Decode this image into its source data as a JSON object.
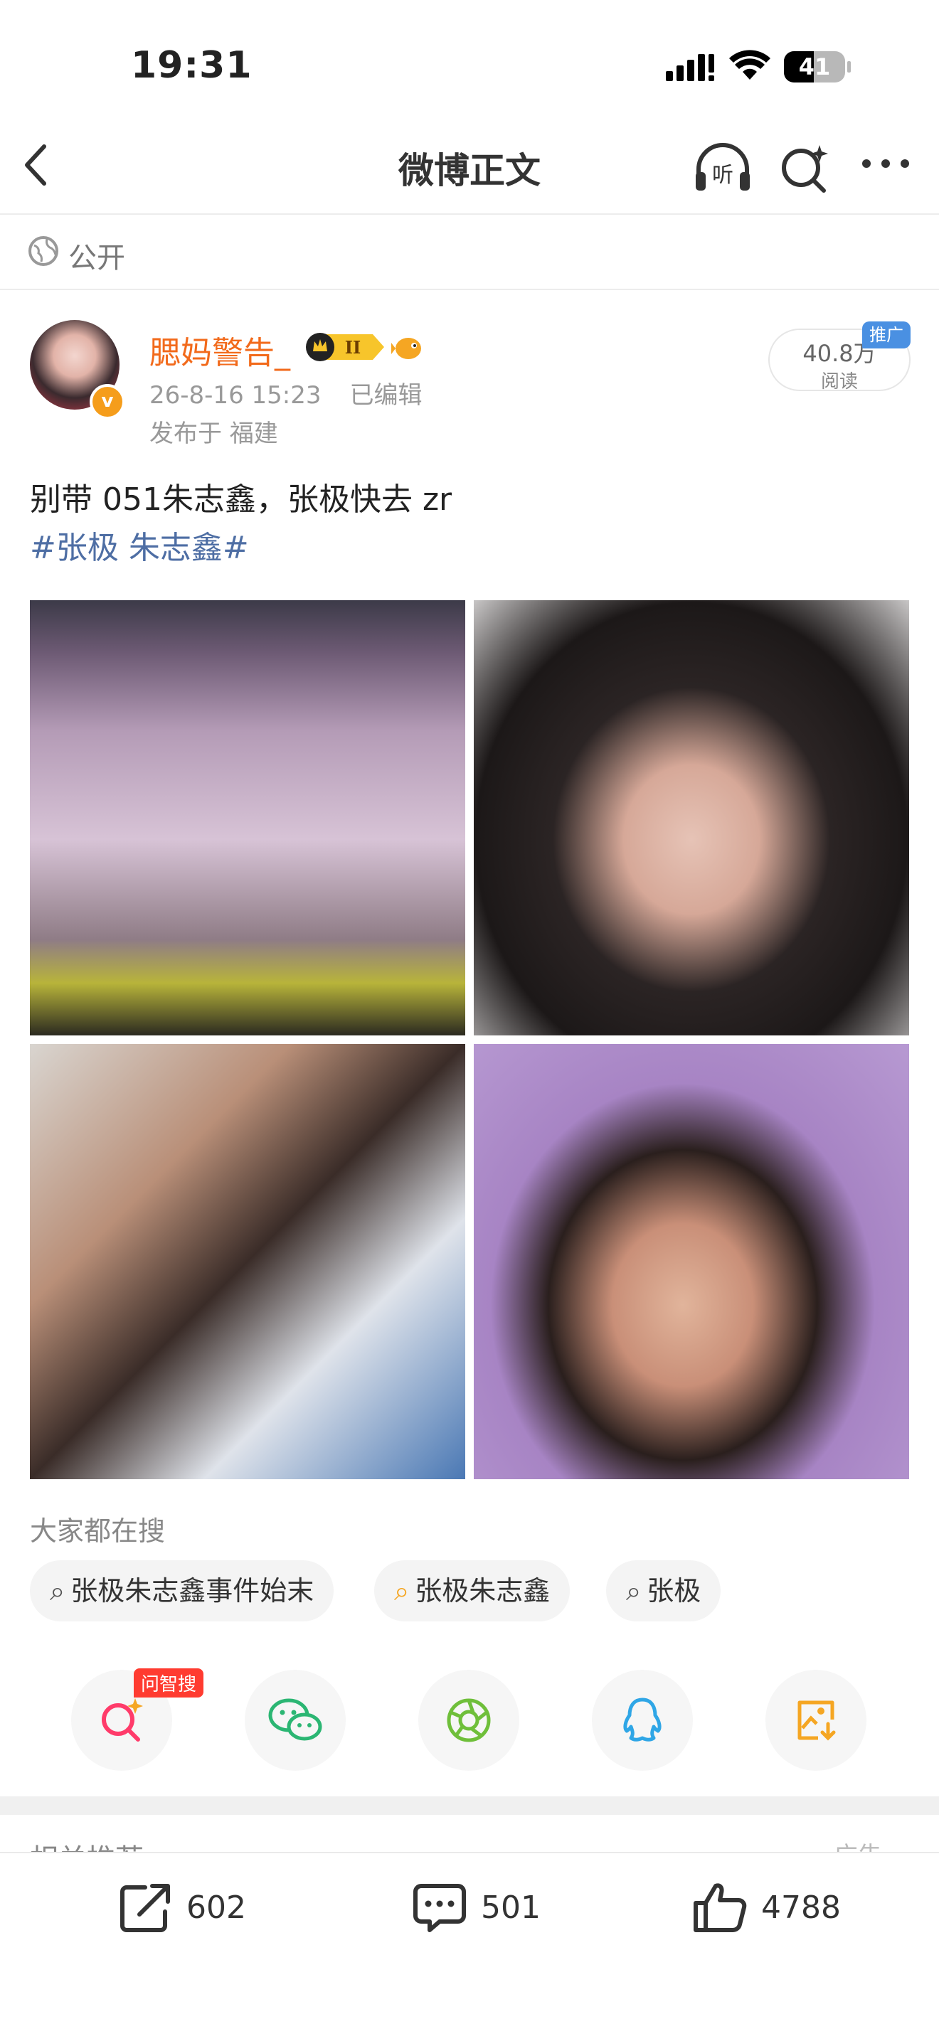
{
  "status_bar": {
    "time": "19:31",
    "battery": "41"
  },
  "nav": {
    "title": "微博正文"
  },
  "visibility": "公开",
  "post": {
    "author": "腮妈警告_",
    "time": "26-8-16 15:23",
    "edited": "已编辑",
    "location": "发布于 福建",
    "views": "40.8万",
    "views_label": "阅读",
    "promo": "推广",
    "text": "别带 051朱志鑫，张极快去 zr",
    "hashtag": "#张极 朱志鑫#"
  },
  "hot_search": {
    "title": "大家都在搜",
    "chips": [
      "张极朱志鑫事件始末",
      "张极朱志鑫",
      "张极"
    ]
  },
  "share": {
    "ask_badge": "问智搜"
  },
  "related": {
    "title": "相关推荐",
    "ad": "广告"
  },
  "actions": {
    "share_count": "602",
    "comment_count": "501",
    "like_count": "4788"
  },
  "colors": {
    "accent": "#f26a1b",
    "link": "#4e6ea4",
    "promo": "#4a90e2",
    "badge_red": "#ff3b30"
  }
}
